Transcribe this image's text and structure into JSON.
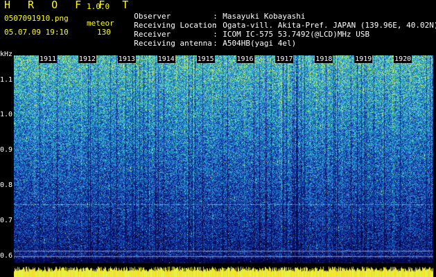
{
  "app": {
    "title": "H R O F F T",
    "version": "1.0.0"
  },
  "file": {
    "name": "0507091910.png",
    "mode": "meteor",
    "datetime": "05.07.09 19:10",
    "count": "130"
  },
  "info": [
    {
      "key": "Observer",
      "value": "Masayuki Kobayashi"
    },
    {
      "key": "Receiving Location",
      "value": "Ogata-vill. Akita-Pref. JAPAN (139.96E, 40.02N)"
    },
    {
      "key": "Receiver",
      "value": "ICOM IC-575 53.7492(@LCD)MHz USB"
    },
    {
      "key": "Receiving antenna",
      "value": "A504HB(yagi 4el)"
    }
  ],
  "separator": ":",
  "chart_data": {
    "type": "heatmap",
    "ylabel": "kHz",
    "y_ticks": [
      "1.1",
      "1.0",
      "0.9",
      "0.8",
      "0.7",
      "0.6"
    ],
    "x_ticks": [
      "1911",
      "1912",
      "1913",
      "1914",
      "1915",
      "1916",
      "1917",
      "1918",
      "1919",
      "1920"
    ],
    "ylim": [
      0.58,
      1.17
    ],
    "colors": {
      "bg": "#000033",
      "low": "#0a1a8c",
      "mid": "#1f6fd0",
      "high": "#3fd0c8",
      "peak": "#e8f040"
    }
  }
}
